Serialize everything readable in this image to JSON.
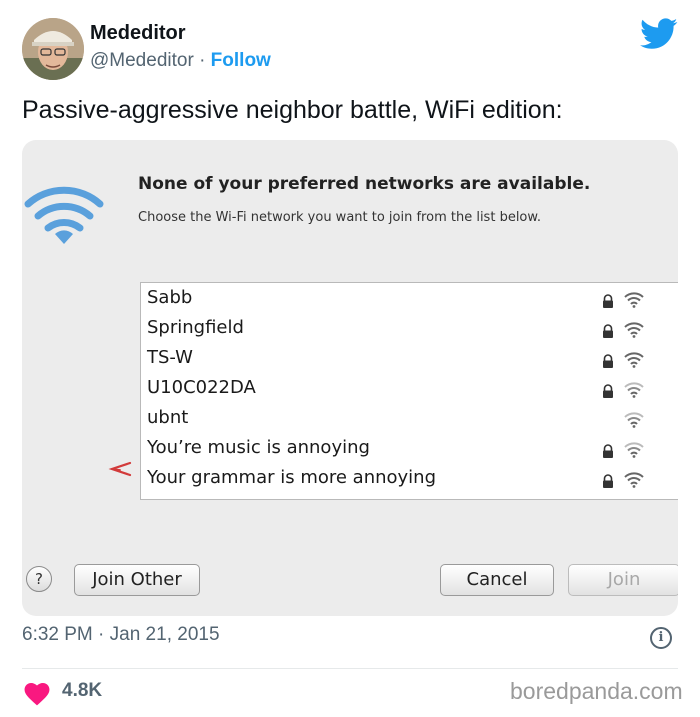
{
  "tweet": {
    "author_name": "Mededitor",
    "author_handle": "@Mededitor",
    "separator": "·",
    "follow_label": "Follow",
    "text": "Passive-aggressive neighbor battle, WiFi edition:",
    "timestamp": "6:32 PM · Jan 21, 2015",
    "likes": "4.8K",
    "icons": [
      "twitter-bird-icon",
      "info-icon",
      "heart-icon"
    ],
    "colors": {
      "accent": "#1d9bf0",
      "like": "#f91880",
      "muted": "#536471"
    }
  },
  "dialog": {
    "heading": "None of your preferred networks are available.",
    "subheading": "Choose the Wi-Fi network you want to join from the list below.",
    "networks": [
      {
        "name": "Sabb",
        "locked": true
      },
      {
        "name": "Springfield",
        "locked": true
      },
      {
        "name": "TS-W",
        "locked": true
      },
      {
        "name": "U10C022DA",
        "locked": true
      },
      {
        "name": "ubnt",
        "locked": false
      },
      {
        "name": "You’re music is annoying",
        "locked": true
      },
      {
        "name": "Your grammar is more annoying",
        "locked": true
      }
    ],
    "help_label": "?",
    "join_other_label": "Join Other",
    "cancel_label": "Cancel",
    "join_label": "Join"
  },
  "watermark": "boredpanda.com"
}
